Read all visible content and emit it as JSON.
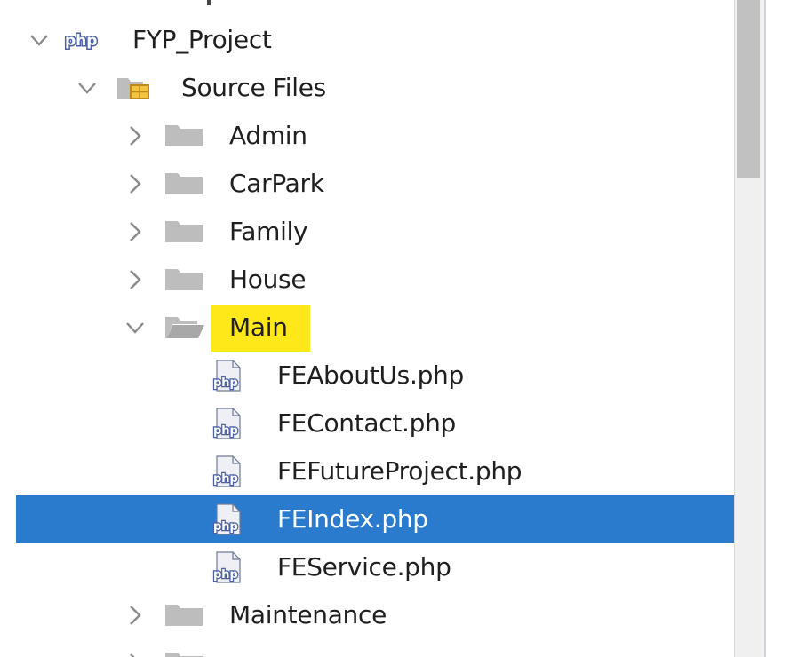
{
  "colors": {
    "selection": "#2a7bcd",
    "highlight": "#ffe81a",
    "folder": "#bdbdbd",
    "php_blue": "#4a5fa8"
  },
  "tree": {
    "rows": [
      {
        "label": "FYP_Project",
        "depth": 0,
        "expanded": true,
        "icon": "php-project-icon"
      },
      {
        "label": "Source Files",
        "depth": 1,
        "expanded": true,
        "icon": "source-folder-icon"
      },
      {
        "label": "Admin",
        "depth": 2,
        "expanded": false,
        "icon": "folder-icon"
      },
      {
        "label": "CarPark",
        "depth": 2,
        "expanded": false,
        "icon": "folder-icon"
      },
      {
        "label": "Family",
        "depth": 2,
        "expanded": false,
        "icon": "folder-icon"
      },
      {
        "label": "House",
        "depth": 2,
        "expanded": false,
        "icon": "folder-icon"
      },
      {
        "label": "Main",
        "depth": 2,
        "expanded": true,
        "icon": "open-folder-icon",
        "highlighted": true
      },
      {
        "label": "FEAboutUs.php",
        "depth": 3,
        "icon": "php-file-icon"
      },
      {
        "label": "FEContact.php",
        "depth": 3,
        "icon": "php-file-icon"
      },
      {
        "label": "FEFutureProject.php",
        "depth": 3,
        "icon": "php-file-icon"
      },
      {
        "label": "FEIndex.php",
        "depth": 3,
        "icon": "php-file-icon",
        "selected": true
      },
      {
        "label": "FEService.php",
        "depth": 3,
        "icon": "php-file-icon"
      },
      {
        "label": "Maintenance",
        "depth": 2,
        "expanded": false,
        "icon": "folder-icon"
      }
    ]
  }
}
